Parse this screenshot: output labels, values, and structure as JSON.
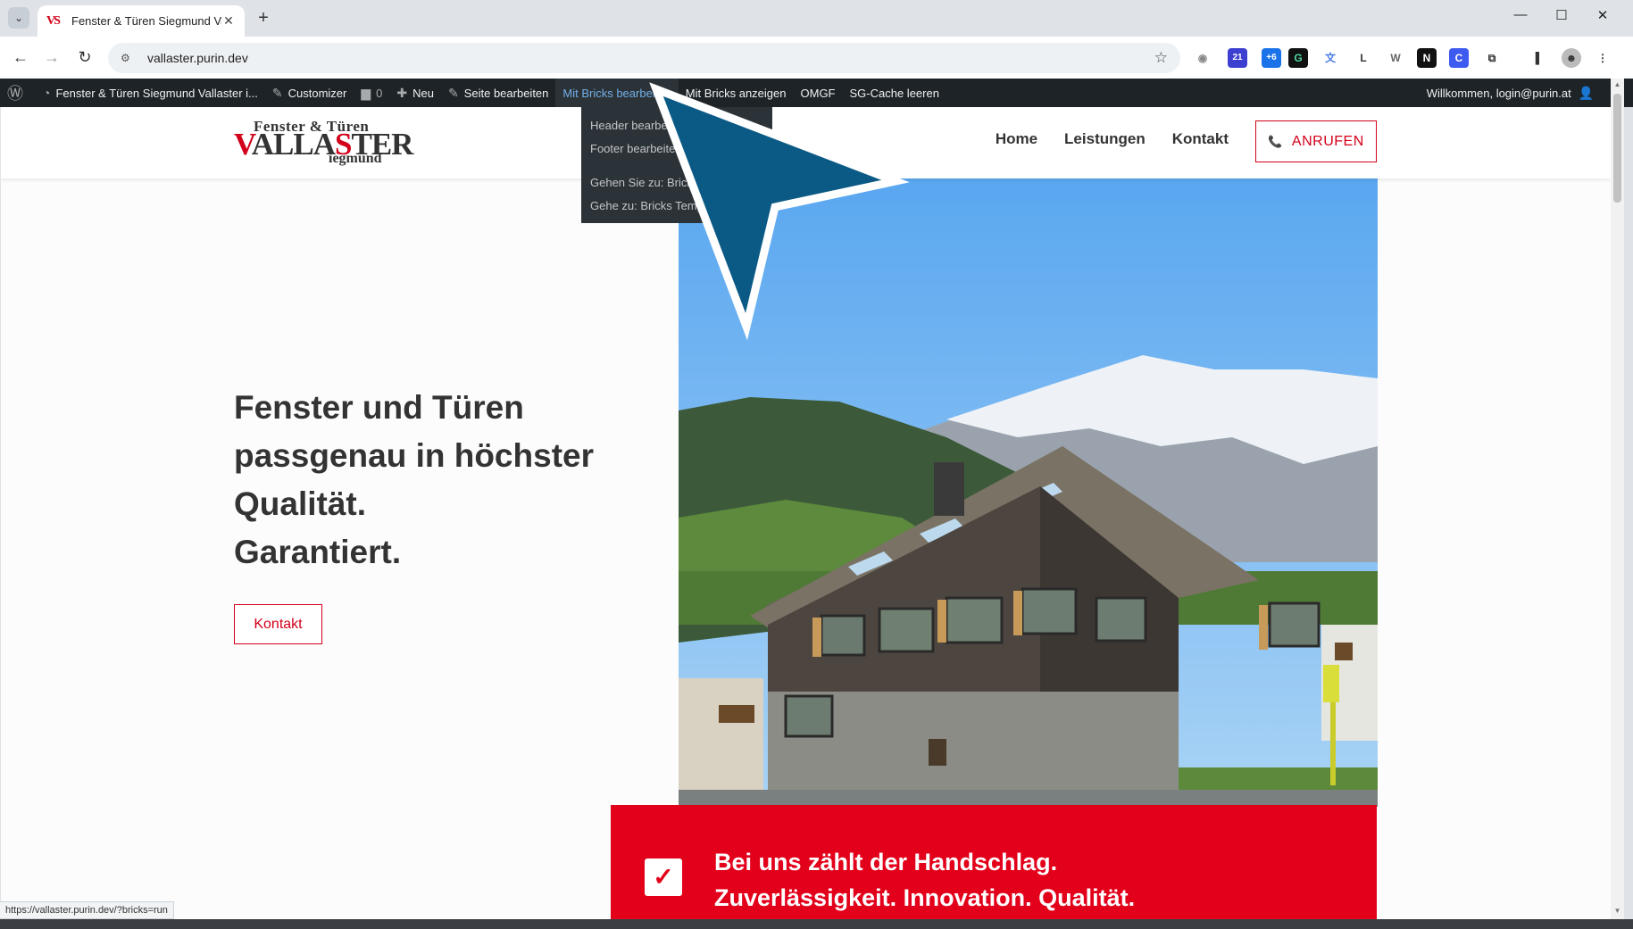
{
  "browser": {
    "tab": {
      "title": "Fenster & Türen Siegmund Vall",
      "favicon_text": "VS",
      "close_glyph": "✕"
    },
    "new_tab_glyph": "+",
    "window_controls": {
      "minimize": "—",
      "maximize": "☐",
      "close": "✕"
    },
    "nav": {
      "back": "←",
      "forward": "→",
      "reload": "↻"
    },
    "url": "vallaster.purin.dev",
    "extensions": [
      "camera-icon",
      "21",
      "+6",
      "grammar-icon",
      "translate-icon",
      "L",
      "W",
      "N",
      "C",
      "puzzle-icon",
      "sidebar-icon",
      "profile-icon",
      "menu-icon"
    ]
  },
  "adminbar": {
    "wp_logo": "wordpress-icon",
    "site_name": "Fenster & Türen Siegmund Vallaster i...",
    "customizer": "Customizer",
    "comments": "0",
    "new": "Neu",
    "edit_page": "Seite bearbeiten",
    "edit_bricks": "Mit Bricks bearbeiten",
    "view_bricks": "Mit Bricks anzeigen",
    "omgf": "OMGF",
    "sg_cache": "SG-Cache leeren",
    "welcome": "Willkommen, login@purin.at",
    "dropdown": [
      "Header bearbeiten",
      "Footer bearbeiten",
      "Gehen Sie zu: Bricks",
      "Gehe zu: Bricks Templates"
    ]
  },
  "site": {
    "logo": {
      "line1": "Fenster & Türen",
      "line2_a": "V",
      "line2_b": "ALLA",
      "line2_c": "S",
      "line2_d": "TER",
      "line3": "iegmund"
    },
    "nav": [
      "Home",
      "Leistungen",
      "Kontakt"
    ],
    "call_button": "ANRUFEN",
    "hero": {
      "lines": [
        "Fenster und Türen",
        "passgenau in höchster",
        "Qualität.",
        "Garantiert."
      ],
      "button": "Kontakt"
    },
    "banner": {
      "line1": "Bei uns zählt der Handschlag.",
      "line2": "Zuverlässigkeit. Innovation. Qualität."
    }
  },
  "statusbar": "https://vallaster.purin.dev/?bricks=run",
  "colors": {
    "brand_red": "#e2001a",
    "adminbar": "#1d2327",
    "link_active": "#72aee6",
    "cursor": "#0b5a85"
  }
}
